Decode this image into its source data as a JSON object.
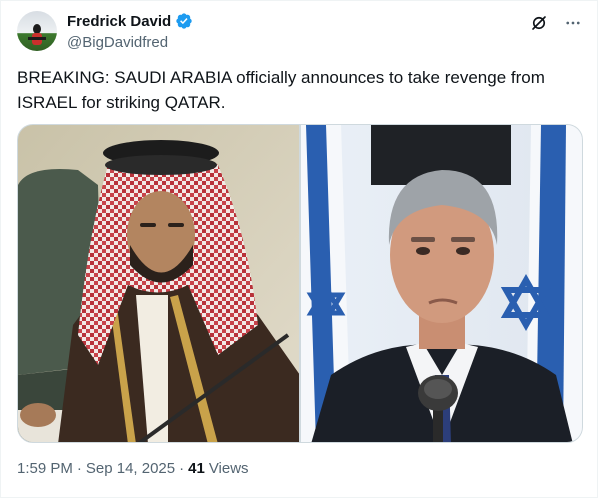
{
  "author": {
    "display_name": "Fredrick David",
    "handle": "@BigDavidfred",
    "verified": true
  },
  "tweet": {
    "text": "BREAKING: SAUDI ARABIA officially announces to take revenge from ISRAEL for striking QATAR."
  },
  "meta": {
    "time": "1:59 PM",
    "separator": "·",
    "date": "Sep 14, 2025",
    "views_count": "41",
    "views_label": "Views"
  },
  "icons": {
    "grok": "grok-icon",
    "more": "more-icon",
    "verified": "verified-badge-icon"
  },
  "colors": {
    "verified": "#1d9bf0",
    "secondary_text": "#536471",
    "primary_text": "#0f1419",
    "border": "#cfd9de"
  }
}
